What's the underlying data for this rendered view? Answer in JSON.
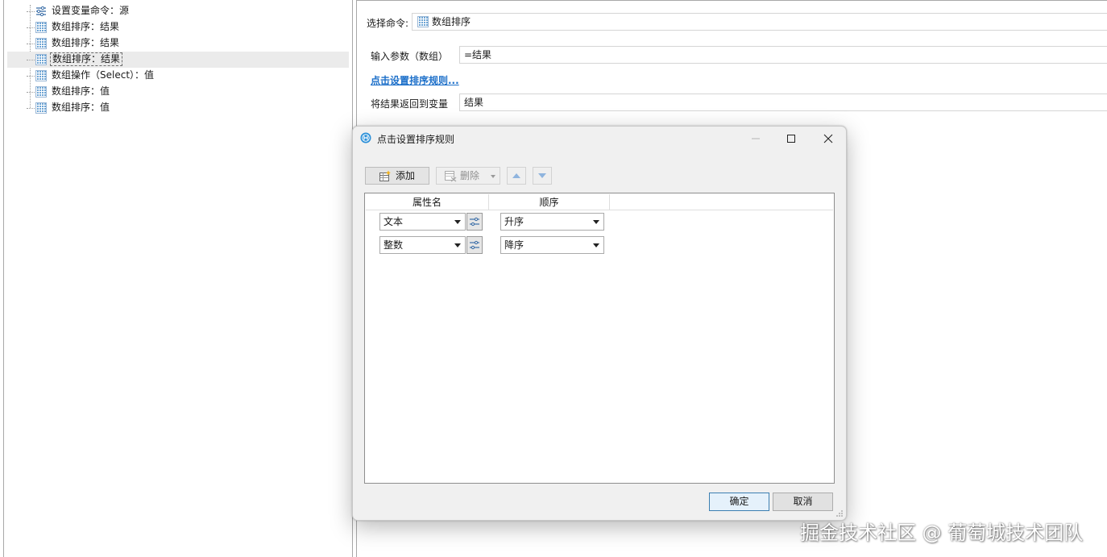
{
  "tree": {
    "items": [
      {
        "label": "设置变量命令：源",
        "icon": "variable-settings-icon"
      },
      {
        "label": "数组排序：结果",
        "icon": "array-icon"
      },
      {
        "label": "数组排序：结果",
        "icon": "array-icon"
      },
      {
        "label": "数组排序：结果",
        "icon": "array-icon",
        "selected": true
      },
      {
        "label": "数组操作（Select）：值",
        "icon": "array-icon"
      },
      {
        "label": "数组排序：值",
        "icon": "array-icon"
      },
      {
        "label": "数组排序：值",
        "icon": "array-icon"
      }
    ]
  },
  "properties": {
    "command_label": "选择命令:",
    "command_value": "数组排序",
    "input_label": "输入参数（数组）",
    "input_value": "=结果",
    "sort_rule_link": "点击设置排序规则...",
    "return_label": "将结果返回到变量",
    "return_value": "结果"
  },
  "dialog": {
    "title": "点击设置排序规则",
    "toolbar": {
      "add_label": "添加",
      "delete_label": "删除"
    },
    "grid": {
      "columns": [
        "属性名",
        "顺序"
      ],
      "rows": [
        {
          "property": "文本",
          "order": "升序"
        },
        {
          "property": "整数",
          "order": "降序"
        }
      ]
    },
    "ok_label": "确定",
    "cancel_label": "取消"
  },
  "watermark": "掘金技术社区 @ 葡萄城技术团队",
  "colors": {
    "link": "#1c6fc9",
    "selected_row": "#ebebeb",
    "dialog_bg": "#f0f0f0",
    "default_button_border": "#3c7fb1"
  }
}
